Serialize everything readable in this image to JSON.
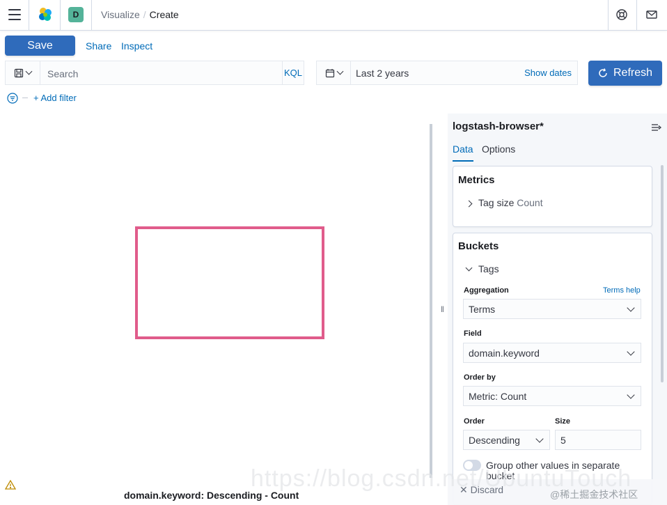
{
  "header": {
    "space_initial": "D",
    "breadcrumbs": [
      "Visualize",
      "Create"
    ]
  },
  "actions": {
    "save": "Save",
    "share": "Share",
    "inspect": "Inspect"
  },
  "query": {
    "placeholder": "Search",
    "language": "KQL"
  },
  "time": {
    "range": "Last 2 years",
    "show_dates": "Show dates",
    "refresh": "Refresh"
  },
  "filters": {
    "add": "+ Add filter"
  },
  "visualization": {
    "bottom_label": "domain.keyword: Descending - Count"
  },
  "sidebar": {
    "index_pattern": "logstash-browser*",
    "tabs": [
      "Data",
      "Options"
    ],
    "metrics": {
      "title": "Metrics",
      "item_name": "Tag size",
      "item_type": "Count"
    },
    "buckets": {
      "title": "Buckets",
      "item_name": "Tags",
      "aggregation_label": "Aggregation",
      "terms_help": "Terms help",
      "aggregation_value": "Terms",
      "field_label": "Field",
      "field_value": "domain.keyword",
      "order_by_label": "Order by",
      "order_by_value": "Metric: Count",
      "order_label": "Order",
      "order_value": "Descending",
      "size_label": "Size",
      "size_value": "5",
      "group_other_label": "Group other values in separate",
      "group_other_label_2": "bucket"
    },
    "discard": "Discard"
  },
  "watermark": {
    "main": "https://blog.csdn.net/UbuntuTouch",
    "sub": "@稀土掘金技术社区"
  },
  "colors": {
    "primary": "#2f6bbb",
    "link": "#006bb8",
    "highlight_box": "#e05c8b",
    "space_avatar": "#54b399"
  }
}
